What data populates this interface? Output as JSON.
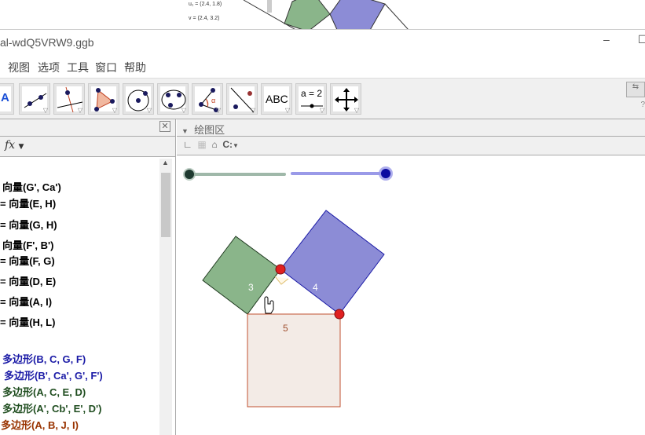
{
  "background_window": {
    "vector_u": "u₁ = (2.4, 1.8)",
    "vector_v": "v = (2.4, 3.2)"
  },
  "window": {
    "title": "al-wdQ5VRW9.ggb",
    "minimize": "–",
    "maximize": "☐"
  },
  "menu": [
    "视图",
    "选项",
    "工具",
    "窗口",
    "帮助"
  ],
  "toolbar": {
    "text_tool": "ABC",
    "slider_tool": "a = 2",
    "tools": [
      "move",
      "line",
      "perpendicular",
      "polygon",
      "circle",
      "conic",
      "angle",
      "reflect",
      "text",
      "slider",
      "move-view"
    ]
  },
  "algebra": {
    "fx": "fx",
    "items": [
      {
        "text": "向量(G', Ca')",
        "color": "#000000"
      },
      {
        "text": "= 向量(E, H)",
        "color": "#000000"
      },
      {
        "text": "= 向量(G, H)",
        "color": "#000000"
      },
      {
        "text": "向量(F', B')",
        "color": "#000000"
      },
      {
        "text": "= 向量(F, G)",
        "color": "#000000"
      },
      {
        "text": "= 向量(D, E)",
        "color": "#000000"
      },
      {
        "text": "= 向量(A, I)",
        "color": "#000000"
      },
      {
        "text": "= 向量(H, L)",
        "color": "#000000"
      },
      {
        "text": "多边形(B, C, G, F)",
        "color": "#1a1aa6"
      },
      {
        "text": "多边形(B', Ca', G', F')",
        "color": "#1a1aa6"
      },
      {
        "text": "多边形(A, C, E, D)",
        "color": "#1f4d1f"
      },
      {
        "text": "多边形(A', Cb', E', D')",
        "color": "#1f4d1f"
      },
      {
        "text": "多边形(A, B, J, I)",
        "color": "#993300"
      }
    ]
  },
  "graphics": {
    "title": "绘图区",
    "graphics_options": "C:",
    "slider1_value": 0,
    "slider2_value": 1,
    "labels": {
      "green": "3",
      "blue": "4",
      "pink": "5"
    }
  }
}
